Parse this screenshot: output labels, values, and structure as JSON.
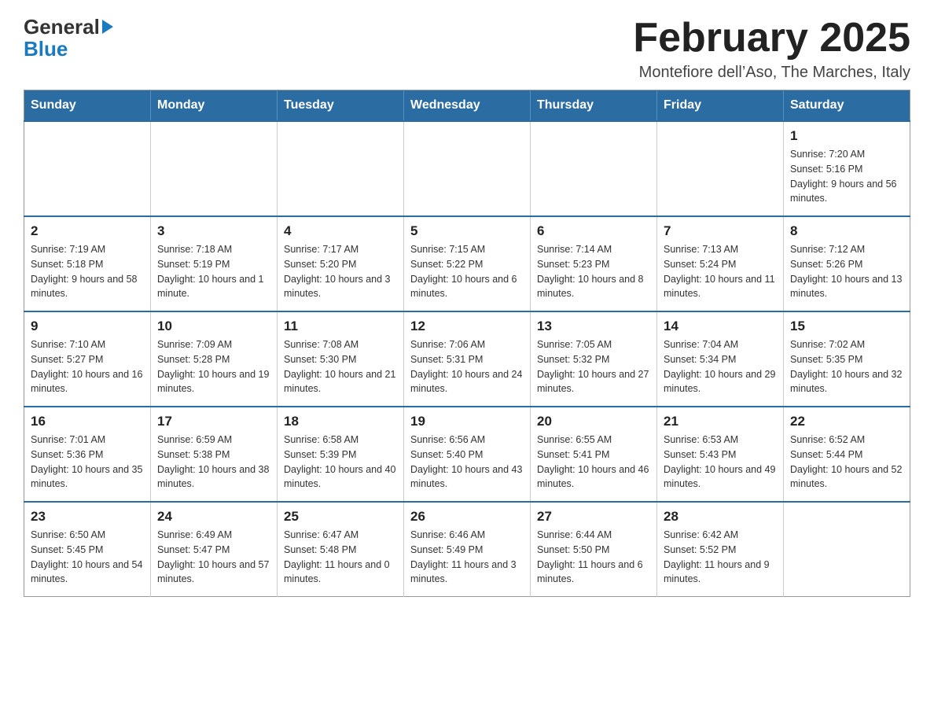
{
  "logo": {
    "line1": "General",
    "line2": "Blue"
  },
  "title": "February 2025",
  "subtitle": "Montefiore dell’Aso, The Marches, Italy",
  "days_of_week": [
    "Sunday",
    "Monday",
    "Tuesday",
    "Wednesday",
    "Thursday",
    "Friday",
    "Saturday"
  ],
  "weeks": [
    [
      {
        "day": "",
        "sunrise": "",
        "sunset": "",
        "daylight": ""
      },
      {
        "day": "",
        "sunrise": "",
        "sunset": "",
        "daylight": ""
      },
      {
        "day": "",
        "sunrise": "",
        "sunset": "",
        "daylight": ""
      },
      {
        "day": "",
        "sunrise": "",
        "sunset": "",
        "daylight": ""
      },
      {
        "day": "",
        "sunrise": "",
        "sunset": "",
        "daylight": ""
      },
      {
        "day": "",
        "sunrise": "",
        "sunset": "",
        "daylight": ""
      },
      {
        "day": "1",
        "sunrise": "Sunrise: 7:20 AM",
        "sunset": "Sunset: 5:16 PM",
        "daylight": "Daylight: 9 hours and 56 minutes."
      }
    ],
    [
      {
        "day": "2",
        "sunrise": "Sunrise: 7:19 AM",
        "sunset": "Sunset: 5:18 PM",
        "daylight": "Daylight: 9 hours and 58 minutes."
      },
      {
        "day": "3",
        "sunrise": "Sunrise: 7:18 AM",
        "sunset": "Sunset: 5:19 PM",
        "daylight": "Daylight: 10 hours and 1 minute."
      },
      {
        "day": "4",
        "sunrise": "Sunrise: 7:17 AM",
        "sunset": "Sunset: 5:20 PM",
        "daylight": "Daylight: 10 hours and 3 minutes."
      },
      {
        "day": "5",
        "sunrise": "Sunrise: 7:15 AM",
        "sunset": "Sunset: 5:22 PM",
        "daylight": "Daylight: 10 hours and 6 minutes."
      },
      {
        "day": "6",
        "sunrise": "Sunrise: 7:14 AM",
        "sunset": "Sunset: 5:23 PM",
        "daylight": "Daylight: 10 hours and 8 minutes."
      },
      {
        "day": "7",
        "sunrise": "Sunrise: 7:13 AM",
        "sunset": "Sunset: 5:24 PM",
        "daylight": "Daylight: 10 hours and 11 minutes."
      },
      {
        "day": "8",
        "sunrise": "Sunrise: 7:12 AM",
        "sunset": "Sunset: 5:26 PM",
        "daylight": "Daylight: 10 hours and 13 minutes."
      }
    ],
    [
      {
        "day": "9",
        "sunrise": "Sunrise: 7:10 AM",
        "sunset": "Sunset: 5:27 PM",
        "daylight": "Daylight: 10 hours and 16 minutes."
      },
      {
        "day": "10",
        "sunrise": "Sunrise: 7:09 AM",
        "sunset": "Sunset: 5:28 PM",
        "daylight": "Daylight: 10 hours and 19 minutes."
      },
      {
        "day": "11",
        "sunrise": "Sunrise: 7:08 AM",
        "sunset": "Sunset: 5:30 PM",
        "daylight": "Daylight: 10 hours and 21 minutes."
      },
      {
        "day": "12",
        "sunrise": "Sunrise: 7:06 AM",
        "sunset": "Sunset: 5:31 PM",
        "daylight": "Daylight: 10 hours and 24 minutes."
      },
      {
        "day": "13",
        "sunrise": "Sunrise: 7:05 AM",
        "sunset": "Sunset: 5:32 PM",
        "daylight": "Daylight: 10 hours and 27 minutes."
      },
      {
        "day": "14",
        "sunrise": "Sunrise: 7:04 AM",
        "sunset": "Sunset: 5:34 PM",
        "daylight": "Daylight: 10 hours and 29 minutes."
      },
      {
        "day": "15",
        "sunrise": "Sunrise: 7:02 AM",
        "sunset": "Sunset: 5:35 PM",
        "daylight": "Daylight: 10 hours and 32 minutes."
      }
    ],
    [
      {
        "day": "16",
        "sunrise": "Sunrise: 7:01 AM",
        "sunset": "Sunset: 5:36 PM",
        "daylight": "Daylight: 10 hours and 35 minutes."
      },
      {
        "day": "17",
        "sunrise": "Sunrise: 6:59 AM",
        "sunset": "Sunset: 5:38 PM",
        "daylight": "Daylight: 10 hours and 38 minutes."
      },
      {
        "day": "18",
        "sunrise": "Sunrise: 6:58 AM",
        "sunset": "Sunset: 5:39 PM",
        "daylight": "Daylight: 10 hours and 40 minutes."
      },
      {
        "day": "19",
        "sunrise": "Sunrise: 6:56 AM",
        "sunset": "Sunset: 5:40 PM",
        "daylight": "Daylight: 10 hours and 43 minutes."
      },
      {
        "day": "20",
        "sunrise": "Sunrise: 6:55 AM",
        "sunset": "Sunset: 5:41 PM",
        "daylight": "Daylight: 10 hours and 46 minutes."
      },
      {
        "day": "21",
        "sunrise": "Sunrise: 6:53 AM",
        "sunset": "Sunset: 5:43 PM",
        "daylight": "Daylight: 10 hours and 49 minutes."
      },
      {
        "day": "22",
        "sunrise": "Sunrise: 6:52 AM",
        "sunset": "Sunset: 5:44 PM",
        "daylight": "Daylight: 10 hours and 52 minutes."
      }
    ],
    [
      {
        "day": "23",
        "sunrise": "Sunrise: 6:50 AM",
        "sunset": "Sunset: 5:45 PM",
        "daylight": "Daylight: 10 hours and 54 minutes."
      },
      {
        "day": "24",
        "sunrise": "Sunrise: 6:49 AM",
        "sunset": "Sunset: 5:47 PM",
        "daylight": "Daylight: 10 hours and 57 minutes."
      },
      {
        "day": "25",
        "sunrise": "Sunrise: 6:47 AM",
        "sunset": "Sunset: 5:48 PM",
        "daylight": "Daylight: 11 hours and 0 minutes."
      },
      {
        "day": "26",
        "sunrise": "Sunrise: 6:46 AM",
        "sunset": "Sunset: 5:49 PM",
        "daylight": "Daylight: 11 hours and 3 minutes."
      },
      {
        "day": "27",
        "sunrise": "Sunrise: 6:44 AM",
        "sunset": "Sunset: 5:50 PM",
        "daylight": "Daylight: 11 hours and 6 minutes."
      },
      {
        "day": "28",
        "sunrise": "Sunrise: 6:42 AM",
        "sunset": "Sunset: 5:52 PM",
        "daylight": "Daylight: 11 hours and 9 minutes."
      },
      {
        "day": "",
        "sunrise": "",
        "sunset": "",
        "daylight": ""
      }
    ]
  ]
}
